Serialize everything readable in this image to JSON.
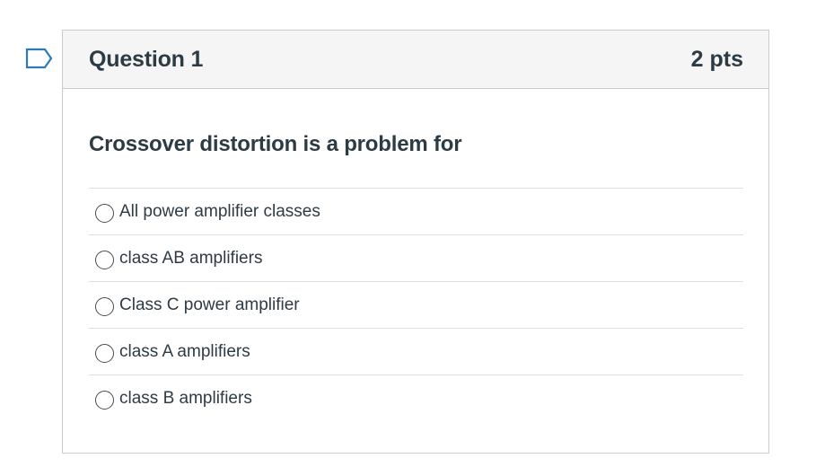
{
  "question": {
    "title": "Question 1",
    "points": "2 pts",
    "text": "Crossover distortion is a problem for",
    "flag_icon": "flag-outline-icon",
    "answers": [
      {
        "label": "All power amplifier classes",
        "selected": false
      },
      {
        "label": "class AB amplifiers",
        "selected": false
      },
      {
        "label": "Class C power amplifier",
        "selected": false
      },
      {
        "label": "class A amplifiers",
        "selected": false
      },
      {
        "label": "class B amplifiers",
        "selected": false
      }
    ]
  },
  "colors": {
    "text": "#2d3b45",
    "header_bg": "#f5f5f5",
    "border": "#c7cdd1",
    "flag": "#2b7abc"
  }
}
